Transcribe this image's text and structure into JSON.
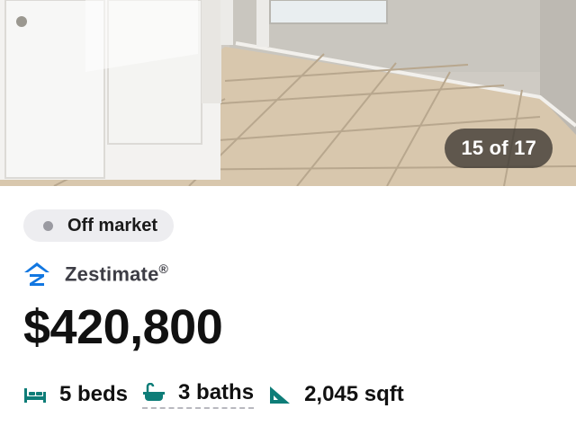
{
  "photo": {
    "counter": "15 of 17"
  },
  "listing": {
    "status": "Off market",
    "estimate_label": "Zestimate",
    "estimate_symbol": "®",
    "price": "$420,800",
    "beds": "5 beds",
    "baths": "3 baths",
    "sqft": "2,045 sqft"
  },
  "icons": {
    "brand": "zillow-logo-icon",
    "beds": "bed-icon",
    "baths": "bathtub-icon",
    "sqft": "ruler-triangle-icon"
  },
  "colors": {
    "brand_blue": "#1277e1",
    "fact_icon_teal": "#0e7d78",
    "status_dot": "#9a9aa1"
  }
}
